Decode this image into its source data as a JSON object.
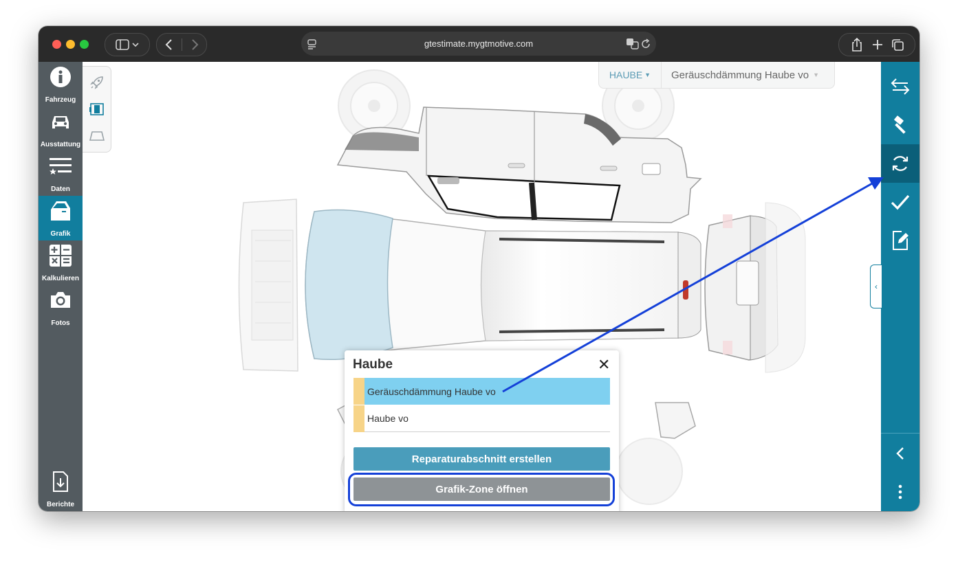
{
  "browser": {
    "url": "gtestimate.mygtmotive.com"
  },
  "leftnav": {
    "items": [
      {
        "label": "Fahrzeug"
      },
      {
        "label": "Ausstattung"
      },
      {
        "label": "Daten"
      },
      {
        "label": "Grafik"
      },
      {
        "label": "Kalkulieren"
      },
      {
        "label": "Fotos"
      }
    ],
    "berichte": "Berichte"
  },
  "header": {
    "zone_dropdown": "HAUBE",
    "part_dropdown": "Geräuschdämmung Haube vo"
  },
  "popup": {
    "title": "Haube",
    "close": "✕",
    "items": [
      {
        "label": "Geräuschdämmung Haube vo",
        "selected": true
      },
      {
        "label": "Haube vo",
        "selected": false
      }
    ],
    "primary_button": "Reparaturabschnitt erstellen",
    "secondary_button": "Grafik-Zone öffnen"
  },
  "colors": {
    "accent": "#117e9e",
    "nav_bg": "#535b60",
    "selected_row": "#7fd0f0",
    "row_marker": "#f7d488",
    "annotation": "#1440d8"
  }
}
